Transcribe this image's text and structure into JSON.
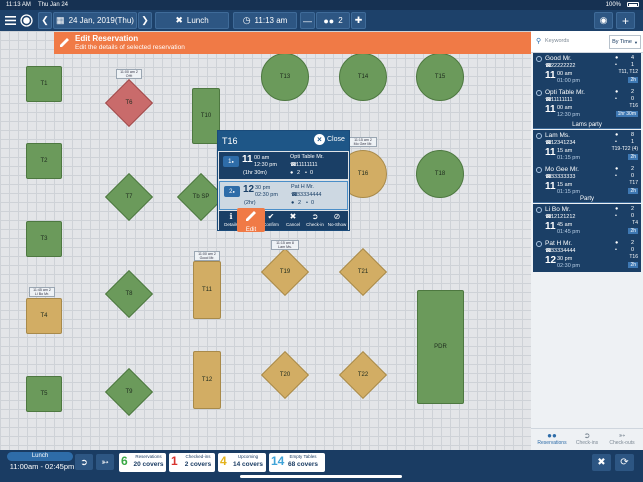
{
  "status_bar": {
    "time": "11:13 AM",
    "date": "Thu Jan 24",
    "battery": "100%"
  },
  "topbar": {
    "date": "24 Jan, 2019(Thu)",
    "shift": "Lunch",
    "time": "11:13 am",
    "party_size": "2"
  },
  "banner": {
    "title": "Edit Reservation",
    "subtitle": "Edit the details of selected reservation"
  },
  "tables": {
    "T1": "T1",
    "T2": "T2",
    "T3": "T3",
    "T4": "T4",
    "T5": "T5",
    "T6": "T6",
    "T7": "T7",
    "T8": "T8",
    "T9": "T9",
    "T10": "T10",
    "T11": "T11",
    "T12": "T12",
    "T13": "T13",
    "T14": "T14",
    "T15": "T15",
    "T16": "T16",
    "T18": "T18",
    "T19": "T19",
    "T20": "T20",
    "T21": "T21",
    "T22": "T22",
    "TbSP": "Tb SP",
    "PDR": "PDR"
  },
  "tags": {
    "t6": "11:00 am 2\nOHt",
    "t4": "11:45 am 2\nLi Bo Mr.",
    "t11": "11:00 am 2\nGood Mr.",
    "t19": "11:15 am 8\nLam Ms.",
    "t16": "11:15 am 2\nMo Gee Mr."
  },
  "popup": {
    "table": "T16",
    "close": "Close",
    "reservations": [
      {
        "num": "1",
        "time": "11",
        "ampm": "00 am",
        "end": "12:30 pm",
        "duration": "(1hr 30m)",
        "name": "Opti Table Mr.",
        "phone": "11111111",
        "adults": "2",
        "kids": "0"
      },
      {
        "num": "2",
        "time": "12",
        "ampm": "30 pm",
        "end": "02:30 pm",
        "duration": "(2hr)",
        "name": "Pat H Mr.",
        "phone": "33334444",
        "adults": "2",
        "kids": "0"
      }
    ],
    "actions": {
      "details": "Details",
      "edit": "Edit",
      "confirm": "Confirm",
      "cancel": "Cancel",
      "checkin": "Check-in",
      "noshow": "No-Show"
    }
  },
  "panel": {
    "search_placeholder": "Keywords",
    "sort": "By Time",
    "cards": [
      {
        "name": "Good Mr.",
        "phone": "22222222",
        "time": "11",
        "ampm": "00 am",
        "end": "01:00 pm",
        "adults": "4",
        "kids": "1",
        "table": "T11, T12",
        "badge": "2h"
      },
      {
        "name": "Opti Table Mr.",
        "phone": "11111111",
        "time": "11",
        "ampm": "00 am",
        "end": "12:30 pm",
        "adults": "2",
        "kids": "0",
        "table": "T16",
        "badge": "1hr 30m"
      },
      {
        "name": "Lam Ms.",
        "phone": "12341234",
        "time": "11",
        "ampm": "15 am",
        "end": "01:15 pm",
        "adults": "8",
        "kids": "1",
        "table": "T19-T22 (4)",
        "badge": "2h"
      },
      {
        "name": "Mo Gee Mr.",
        "phone": "33333333",
        "time": "11",
        "ampm": "15 am",
        "end": "01:15 pm",
        "adults": "2",
        "kids": "0",
        "table": "T17",
        "badge": "2h"
      },
      {
        "name": "Li Bo Mr.",
        "phone": "12121212",
        "time": "11",
        "ampm": "45 am",
        "end": "01:45 pm",
        "adults": "2",
        "kids": "0",
        "table": "T4",
        "badge": "2h"
      },
      {
        "name": "Pat H Mr.",
        "phone": "33334444",
        "time": "12",
        "ampm": "30 pm",
        "end": "02:30 pm",
        "adults": "2",
        "kids": "0",
        "table": "T16",
        "badge": "2h"
      }
    ],
    "sections": {
      "lams": "Lams party",
      "party": "Party"
    },
    "tabs": {
      "reservations": "Reservations",
      "checkins": "Check-ins",
      "checkouts": "Check-outs"
    }
  },
  "bottom": {
    "shift": "Lunch",
    "shift_time": "11:00am - 02:45pm",
    "stats": [
      {
        "n": "6",
        "label": "Reservations",
        "value": "20 covers",
        "color": "#38a845"
      },
      {
        "n": "1",
        "label": "Checked-ins",
        "value": "2 covers",
        "color": "#d8332e"
      },
      {
        "n": "4",
        "label": "Upcoming",
        "value": "14 covers",
        "color": "#e3b21b"
      },
      {
        "n": "14",
        "label": "Empty Tables",
        "value": "68 covers",
        "color": "#3fa3d8"
      }
    ]
  }
}
